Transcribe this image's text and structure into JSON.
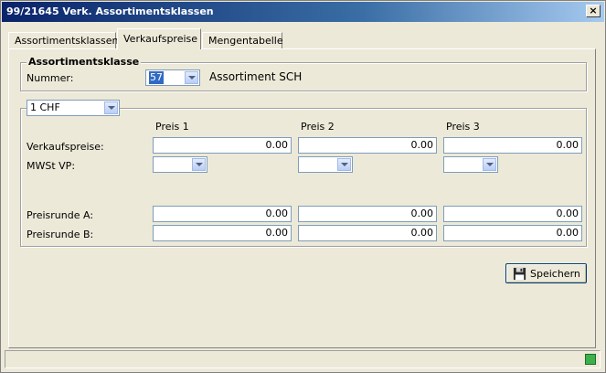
{
  "window": {
    "title": "99/21645 Verk. Assortimentsklassen",
    "close_glyph": "×"
  },
  "tabs": [
    {
      "label": "Assortimentsklassen",
      "active": false
    },
    {
      "label": "Verkaufspreise",
      "active": true
    },
    {
      "label": "Mengentabelle",
      "active": false
    }
  ],
  "assortiment": {
    "group_label": "Assortimentsklasse",
    "nummer_label": "Nummer:",
    "nummer_value": "57",
    "name": "Assortiment SCH"
  },
  "prices": {
    "currency": "1 CHF",
    "columns": [
      "Preis 1",
      "Preis 2",
      "Preis 3"
    ],
    "verkaufspreise_label": "Verkaufspreise:",
    "verkaufspreise": [
      "0.00",
      "0.00",
      "0.00"
    ],
    "mwst_label": "MWSt VP:",
    "mwst": [
      "",
      "",
      ""
    ],
    "preisrunde_a_label": "Preisrunde A:",
    "preisrunde_a": [
      "0.00",
      "0.00",
      "0.00"
    ],
    "preisrunde_b_label": "Preisrunde B:",
    "preisrunde_b": [
      "0.00",
      "0.00",
      "0.00"
    ]
  },
  "actions": {
    "save_label": "Speichern",
    "save_icon": "floppy-disk-icon"
  },
  "colors": {
    "title_gradient_start": "#0a246a",
    "panel_bg": "#ece9d8",
    "field_border": "#7f9db9"
  }
}
